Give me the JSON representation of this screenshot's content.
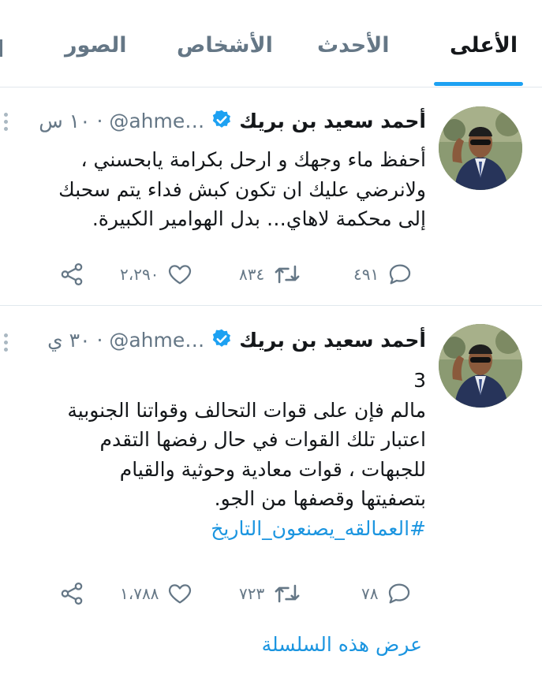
{
  "tabs": [
    {
      "label": "الأعلى"
    },
    {
      "label": "الأحدث"
    },
    {
      "label": "الأشخاص"
    },
    {
      "label": "الصور"
    }
  ],
  "tweets": [
    {
      "name": "أحمد سعيد بن بريك",
      "handle": "@ahme…",
      "time": "١٠ س",
      "lines": [
        "أحفظ ماء وجهك و ارحل بكرامة يابحسني ،",
        "ولانرضي عليك ان تكون كبش فداء يتم سحبك",
        "إلى محكمة لاهاي… بدل الهوامير الكبيرة."
      ],
      "replies": "٤٩١",
      "retweets": "٨٣٤",
      "likes": "٢،٢٩٠"
    },
    {
      "name": "أحمد سعيد بن بريك",
      "handle": "@ahme…",
      "time": "٣٠ ي",
      "lines": [
        "3",
        "مالم فإن على قوات التحالف وقواتنا الجنوبية",
        "اعتبار تلك القوات في حال رفضها التقدم",
        "للجبهات ، قوات معادية وحوثية والقيام",
        "بتصفيتها وقصفها من الجو."
      ],
      "hashtag": "#العمالقه_يصنعون_التاريخ",
      "replies": "٧٨",
      "retweets": "٧٢٣",
      "likes": "١،٧٨٨",
      "show_thread": "عرض هذه السلسلة"
    }
  ],
  "colors": {
    "accent": "#1da1f2",
    "link": "#1b95e0",
    "muted": "#657786"
  }
}
